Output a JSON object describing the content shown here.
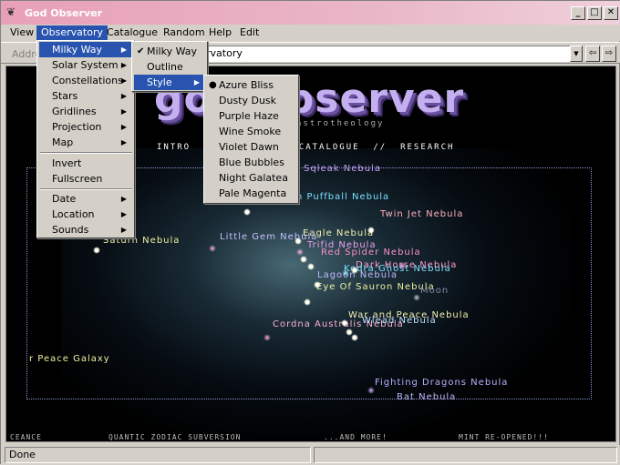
{
  "window": {
    "title": "God Observer",
    "minimize": "_",
    "maximize": "□",
    "close": "✕"
  },
  "menubar": [
    "View",
    "Observatory",
    "Catalogue",
    "Random",
    "Help",
    "Edit"
  ],
  "address": {
    "label": "Addre",
    "value": "rvatory"
  },
  "observatory_menu": {
    "items": [
      "Milky Way",
      "Solar System",
      "Constellations",
      "Stars",
      "Gridlines",
      "Projection",
      "Map",
      "Invert",
      "Fullscreen",
      "Date",
      "Location",
      "Sounds"
    ]
  },
  "milkyway_menu": {
    "items": [
      "Milky Way",
      "Outline",
      "Style"
    ]
  },
  "style_menu": {
    "items": [
      "Azure Bliss",
      "Dusty Dusk",
      "Purple Haze",
      "Wine Smoke",
      "Violet Dawn",
      "Blue Bubbles",
      "Night Galatea",
      "Pale Magenta"
    ]
  },
  "page": {
    "title": "god observer",
    "subtitle": "astrotheology",
    "nav": "INTRO  //        //  CATALOGUE  //  RESEARCH",
    "nebulae": [
      "Sqleak Nebula",
      "n Puffball Nebula",
      "Twin Jet Nebula",
      "Eagle Nebula",
      "Little Gem Nebula",
      "Saturn Nebula",
      "Trifid Nebula",
      "Red Spider Nebula",
      "Dark Horse Nebula",
      "Kedra Ghost Nebula",
      "Lagoon Nebula",
      "Eye Of Sauron Nebula",
      "Moon",
      "War and Peace Nebula",
      "Cordna Australis Nebula",
      "Wlead Nebula",
      "r Peace Galaxy",
      "Fighting Dragons Nebula",
      "Bat Nebula"
    ],
    "footer": [
      "CEANCE",
      "QUANTIC ZODIAC SUBVERSION",
      "...AND MORE!",
      "MINT RE-OPENED!!!"
    ]
  },
  "status": {
    "text": "Done"
  },
  "colors": {
    "title_gradient_start": "#e8a0b8",
    "menu_highlight": "#2854b0",
    "chrome": "#d4d0c8"
  }
}
